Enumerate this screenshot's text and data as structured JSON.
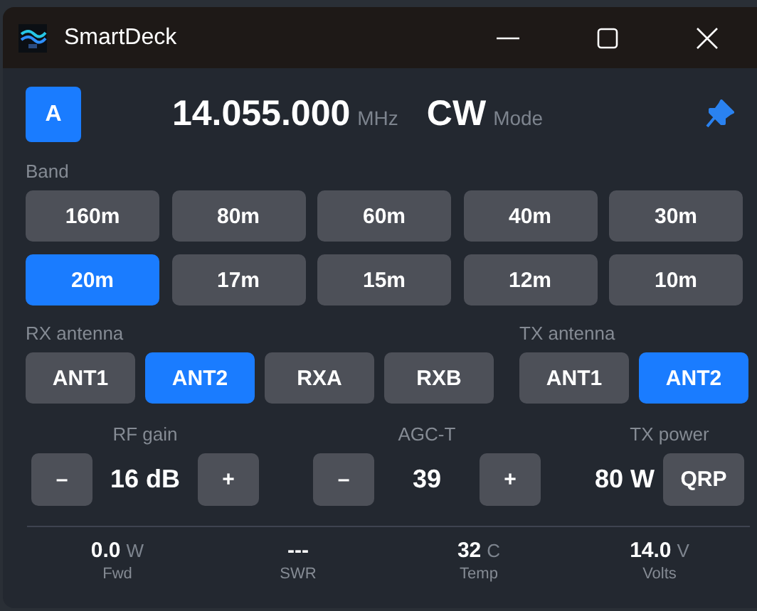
{
  "window": {
    "title": "SmartDeck"
  },
  "header": {
    "vfo": "A",
    "frequency": "14.055.000",
    "frequency_unit": "MHz",
    "mode": "CW",
    "mode_label": "Mode",
    "pinned": true
  },
  "band": {
    "label": "Band",
    "buttons": [
      {
        "label": "160m",
        "selected": false
      },
      {
        "label": "80m",
        "selected": false
      },
      {
        "label": "60m",
        "selected": false
      },
      {
        "label": "40m",
        "selected": false
      },
      {
        "label": "30m",
        "selected": false
      },
      {
        "label": "20m",
        "selected": true
      },
      {
        "label": "17m",
        "selected": false
      },
      {
        "label": "15m",
        "selected": false
      },
      {
        "label": "12m",
        "selected": false
      },
      {
        "label": "10m",
        "selected": false
      }
    ]
  },
  "rx_antenna": {
    "label": "RX antenna",
    "buttons": [
      {
        "label": "ANT1",
        "selected": false
      },
      {
        "label": "ANT2",
        "selected": true
      },
      {
        "label": "RXA",
        "selected": false
      },
      {
        "label": "RXB",
        "selected": false
      }
    ]
  },
  "tx_antenna": {
    "label": "TX antenna",
    "buttons": [
      {
        "label": "ANT1",
        "selected": false
      },
      {
        "label": "ANT2",
        "selected": true
      }
    ]
  },
  "controls": [
    {
      "kind": "stepper",
      "label": "RF gain",
      "minus": "–",
      "value": "16 dB",
      "plus": "+"
    },
    {
      "kind": "stepper",
      "label": "AGC-T",
      "minus": "–",
      "value": "39",
      "plus": "+"
    },
    {
      "kind": "power",
      "label": "TX power",
      "value": "80 W",
      "button": "QRP"
    }
  ],
  "status_bar": [
    {
      "value": "0.0",
      "unit": "W",
      "label": "Fwd"
    },
    {
      "value": "---",
      "label": "SWR"
    },
    {
      "value": "32",
      "unit": "C",
      "label": "Temp"
    },
    {
      "value": "14.0",
      "unit": "V",
      "label": "Volts"
    }
  ]
}
